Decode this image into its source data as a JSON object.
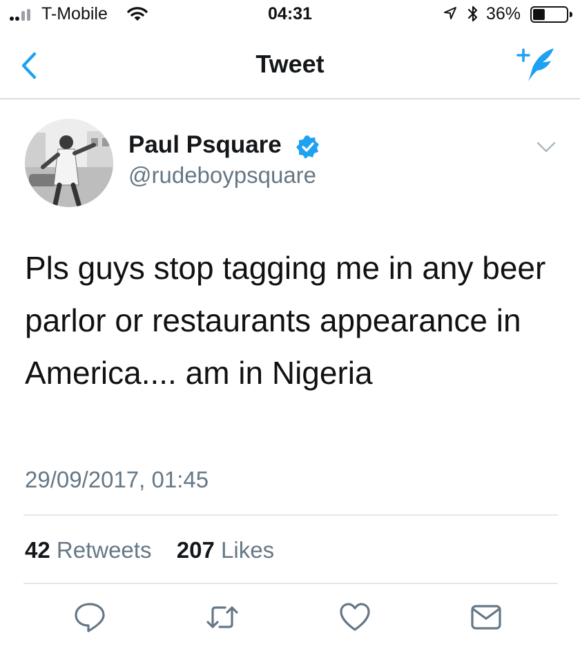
{
  "status_bar": {
    "carrier": "T-Mobile",
    "time": "04:31",
    "battery_percent": "36%",
    "battery_level": 0.36,
    "signal_bars": 2,
    "icons": [
      "signal-icon",
      "wifi-icon",
      "location-arrow-icon",
      "bluetooth-icon",
      "battery-icon"
    ]
  },
  "nav": {
    "title": "Tweet",
    "back_icon": "chevron-left-icon",
    "compose_icon": "compose-tweet-icon"
  },
  "tweet": {
    "author_name": "Paul Psquare",
    "handle": "@rudeboypsquare",
    "verified": true,
    "text": "Pls guys stop tagging me in any beer parlor or restaurants appearance in America.... am in Nigeria",
    "timestamp": "29/09/2017, 01:45"
  },
  "stats": {
    "retweets_count": "42",
    "retweets_label": "Retweets",
    "likes_count": "207",
    "likes_label": "Likes"
  },
  "actions": [
    "reply-icon",
    "retweet-icon",
    "like-icon",
    "direct-message-icon"
  ],
  "colors": {
    "accent": "#1da1f2",
    "text": "#14171a",
    "secondary_text": "#657786",
    "divider": "#e1e8ed"
  }
}
